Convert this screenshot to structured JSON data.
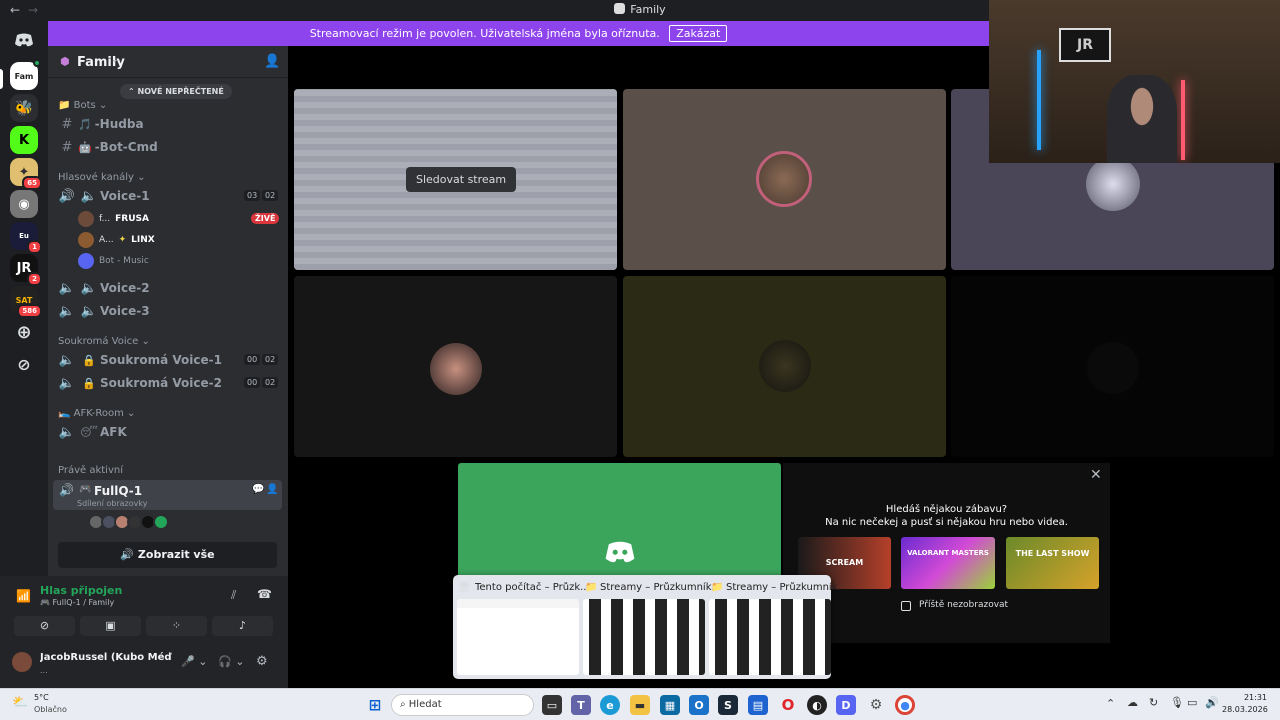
{
  "titlebar": {
    "back": "←",
    "forward": "→",
    "title": "Family"
  },
  "banner": {
    "text": "Streamovací režim je povolen. Uživatelská jména byla oříznuta.",
    "button": "Zakázat"
  },
  "rail": {
    "badges": [
      "65",
      "1",
      "2",
      "586"
    ]
  },
  "guild": {
    "name": "Family"
  },
  "sidebar": {
    "unread_pill": "NOVÉ NEPŘEČTENÉ",
    "cat_bots": "Bots",
    "ch_hudba": "-Hudba",
    "ch_botcmd": "-Bot-Cmd",
    "cat_voice": "Hlasové kanály",
    "voice1": "Voice-1",
    "voice1_counts": [
      "03",
      "02"
    ],
    "member1_name": "f...",
    "member1_tag": "FRUSA",
    "live_badge": "ŽIVĚ",
    "member2_name": "A...",
    "member2_tag": "LINX",
    "member3_name": "Bot - Music",
    "voice2": "Voice-2",
    "voice3": "Voice-3",
    "cat_private": "Soukromá Voice",
    "priv1": "Soukromá Voice-1",
    "priv1_counts": [
      "00",
      "02"
    ],
    "priv2": "Soukromá Voice-2",
    "priv2_counts": [
      "00",
      "02"
    ],
    "cat_afk": "AFK-Room",
    "afk": "AFK",
    "cat_active": "Právě aktivní",
    "active_channel": "FullQ-1",
    "active_sub": "Sdílení obrazovky",
    "show_all": "Zobrazit vše"
  },
  "voice": {
    "status": "Hlas připojen",
    "location": "FullQ-1 / Family",
    "user": "JacobRussel (Kubo Méďo ...",
    "user_status": "..."
  },
  "stage": {
    "watch_stream": "Sledovat stream",
    "promo_line1": "Hledáš nějakou zábavu?",
    "promo_line2": "Na nic nečekej a pusť si nějakou hru nebo videa.",
    "games": [
      "SCREAM",
      "VALORANT MASTERS",
      "THE LAST SHOW"
    ],
    "dont_show": "Příště nezobrazovat"
  },
  "thumbnails": [
    {
      "title": "Tento počítač – Průzk..."
    },
    {
      "title": "Streamy – Průzkumník..."
    },
    {
      "title": "Streamy – Průzkumník..."
    }
  ],
  "taskbar": {
    "weather_temp": "5°C",
    "weather_desc": "Oblačno",
    "search": "Hledat",
    "time": "21:31",
    "date": "28.03.2026"
  },
  "colors": {
    "accent": "#5865f2",
    "banner": "#8e44ec",
    "live": "#da373c",
    "connected": "#23a55a"
  }
}
